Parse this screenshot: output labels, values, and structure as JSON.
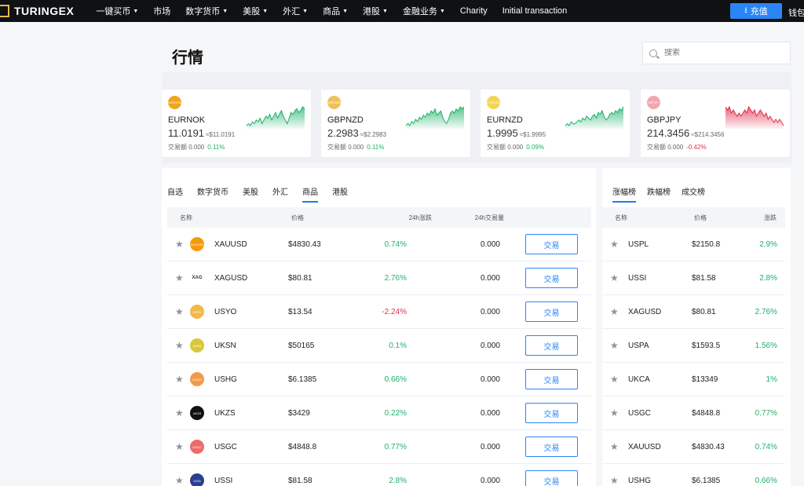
{
  "nav": {
    "logo": "TURINGEX",
    "items": [
      {
        "label": "一键买币",
        "caret": true
      },
      {
        "label": "市场",
        "caret": false
      },
      {
        "label": "数字货币",
        "caret": true
      },
      {
        "label": "美股",
        "caret": true
      },
      {
        "label": "外汇",
        "caret": true
      },
      {
        "label": "商品",
        "caret": true
      },
      {
        "label": "港股",
        "caret": true
      },
      {
        "label": "金融业务",
        "caret": true
      },
      {
        "label": "Charity",
        "caret": false
      },
      {
        "label": "Initial transaction",
        "caret": false
      }
    ],
    "recharge_label": "充值",
    "wallet_label": "钱包"
  },
  "page": {
    "title": "行情",
    "search_placeholder": "搜索"
  },
  "cards": [
    {
      "symbol": "EURNOK",
      "icon_text": "EURNOK",
      "icon_color": "#f0a51a",
      "price": "11.0191",
      "price_ref": "≈$11.0191",
      "volume_label": "交易额",
      "volume": "0.000",
      "change": "0.11%",
      "trend": "up",
      "spark": [
        5,
        6,
        5,
        7,
        6,
        8,
        7,
        9,
        6,
        8,
        10,
        9,
        11,
        8,
        10,
        12,
        9,
        11,
        13,
        10,
        8,
        6,
        9,
        12,
        11,
        13,
        14,
        12,
        13,
        15,
        14
      ]
    },
    {
      "symbol": "GBPNZD",
      "icon_text": "GBPNZD",
      "icon_color": "#f0c15a",
      "price": "2.2983",
      "price_ref": "≈$2.2983",
      "volume_label": "交易额",
      "volume": "0.000",
      "change": "0.11%",
      "trend": "up",
      "spark": [
        6,
        7,
        6,
        8,
        7,
        9,
        8,
        10,
        9,
        11,
        10,
        12,
        11,
        13,
        12,
        14,
        11,
        12,
        13,
        10,
        8,
        7,
        9,
        12,
        13,
        12,
        14,
        13,
        15,
        14,
        15
      ]
    },
    {
      "symbol": "EURNZD",
      "icon_text": "EURNZD",
      "icon_color": "#f3d455",
      "price": "1.9995",
      "price_ref": "≈$1.9995",
      "volume_label": "交易额",
      "volume": "0.000",
      "change": "0.09%",
      "trend": "up",
      "spark": [
        5,
        6,
        5,
        7,
        6,
        6,
        7,
        8,
        7,
        9,
        8,
        10,
        9,
        8,
        10,
        11,
        9,
        12,
        11,
        13,
        10,
        8,
        9,
        11,
        12,
        11,
        13,
        12,
        14,
        13,
        15
      ]
    },
    {
      "symbol": "GBPJPY",
      "icon_text": "GBPJPY",
      "icon_color": "#f2a6ad",
      "price": "214.3456",
      "price_ref": "≈$214.3456",
      "volume_label": "交易额",
      "volume": "0.000",
      "change": "-0.42%",
      "trend": "down",
      "spark": [
        14,
        13,
        14,
        12,
        13,
        12,
        11,
        12,
        11,
        12,
        13,
        12,
        14,
        13,
        12,
        13,
        11,
        12,
        13,
        12,
        11,
        12,
        10,
        11,
        10,
        9,
        10,
        9,
        10,
        9,
        8
      ]
    }
  ],
  "market_tabs": [
    {
      "label": "自选",
      "active": false
    },
    {
      "label": "数字货币",
      "active": false
    },
    {
      "label": "美股",
      "active": false
    },
    {
      "label": "外汇",
      "active": false
    },
    {
      "label": "商品",
      "active": true
    },
    {
      "label": "港股",
      "active": false
    }
  ],
  "table_headers": [
    "名称",
    "价格",
    "24h涨跌",
    "24h交易量"
  ],
  "trade_label": "交易",
  "rows": [
    {
      "name": "XAUUSD",
      "icon_text": "XAUUSD",
      "icon_color": "#f59a0c",
      "price": "$4830.43",
      "change": "0.74%",
      "trend": "up",
      "volume": "0.000"
    },
    {
      "name": "XAGUSD",
      "icon_text": "XAG",
      "icon_color": "#ffffff",
      "price": "$80.81",
      "change": "2.76%",
      "trend": "up",
      "volume": "0.000"
    },
    {
      "name": "USYO",
      "icon_text": "USYO",
      "icon_color": "#f3b84a",
      "price": "$13.54",
      "change": "-2.24%",
      "trend": "down",
      "volume": "0.000"
    },
    {
      "name": "UKSN",
      "icon_text": "UKSN",
      "icon_color": "#d9c738",
      "price": "$50165",
      "change": "0.1%",
      "trend": "up",
      "volume": "0.000"
    },
    {
      "name": "USHG",
      "icon_text": "USHG",
      "icon_color": "#f39a4a",
      "price": "$6.1385",
      "change": "0.66%",
      "trend": "up",
      "volume": "0.000"
    },
    {
      "name": "UKZS",
      "icon_text": "UKZS",
      "icon_color": "#111111",
      "price": "$3429",
      "change": "0.22%",
      "trend": "up",
      "volume": "0.000"
    },
    {
      "name": "USGC",
      "icon_text": "USGC",
      "icon_color": "#ee6a6a",
      "price": "$4848.8",
      "change": "0.77%",
      "trend": "up",
      "volume": "0.000"
    },
    {
      "name": "USSI",
      "icon_text": "USSI",
      "icon_color": "#2a3f8e",
      "price": "$81.58",
      "change": "2.8%",
      "trend": "up",
      "volume": "0.000"
    }
  ],
  "rank_tabs": [
    {
      "label": "涨幅榜",
      "active": true
    },
    {
      "label": "跌幅榜",
      "active": false
    },
    {
      "label": "成交榜",
      "active": false
    }
  ],
  "rank_headers": [
    "名称",
    "价格",
    "涨跌"
  ],
  "rank_rows": [
    {
      "name": "USPL",
      "price": "$2150.8",
      "change": "2.9%"
    },
    {
      "name": "USSI",
      "price": "$81.58",
      "change": "2.8%"
    },
    {
      "name": "XAGUSD",
      "price": "$80.81",
      "change": "2.76%"
    },
    {
      "name": "USPA",
      "price": "$1593.5",
      "change": "1.56%"
    },
    {
      "name": "UKCA",
      "price": "$13349",
      "change": "1%"
    },
    {
      "name": "USGC",
      "price": "$4848.8",
      "change": "0.77%"
    },
    {
      "name": "XAUUSD",
      "price": "$4830.43",
      "change": "0.74%"
    },
    {
      "name": "USHG",
      "price": "$6.1385",
      "change": "0.66%"
    }
  ]
}
